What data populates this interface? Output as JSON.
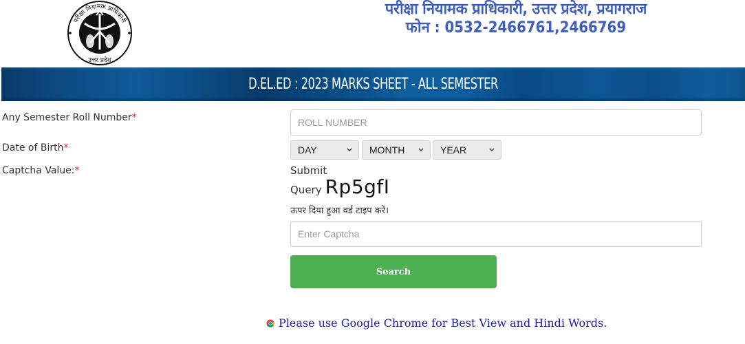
{
  "header": {
    "org_name": "परीक्षा नियामक प्राधिकारी, उत्तर प्रदेश, प्रयागराज",
    "phone": "फोन : 0532-2466761,2466769",
    "logo": {
      "icon": "uttar-pradesh-emblem-icon",
      "top_text": "परीक्षा नियामक प्राधिकारी",
      "bottom_text": "उत्तर प्रदेश"
    }
  },
  "banner": {
    "title": "D.EL.ED : 2023 MARKS SHEET - ALL SEMESTER"
  },
  "form": {
    "roll_number": {
      "label": "Any Semester Roll Number",
      "required_mark": "*",
      "placeholder": "ROLL NUMBER",
      "value": ""
    },
    "dob": {
      "label": "Date of Birth",
      "required_mark": "*",
      "day": {
        "selected": "DAY"
      },
      "month": {
        "selected": "MONTH"
      },
      "year": {
        "selected": "YEAR"
      }
    },
    "captcha": {
      "label": "Captcha Value:",
      "required_mark": "*",
      "submit_text": "Submit",
      "query_text": "Query",
      "code": "Rp5gfI",
      "hint": "ऊपर दिया हुआ वर्ड टाइप करें।",
      "placeholder": "Enter Captcha",
      "value": ""
    },
    "search_button": "Search"
  },
  "footer": {
    "icon": "chrome-icon",
    "note": "Please use Google Chrome for Best View and Hindi Words."
  },
  "colors": {
    "header_text": "#3f5fbf",
    "banner": "#0d4d86",
    "required": "#e0273a",
    "button": "#4caf50",
    "footer_text": "#1a1aa6"
  }
}
